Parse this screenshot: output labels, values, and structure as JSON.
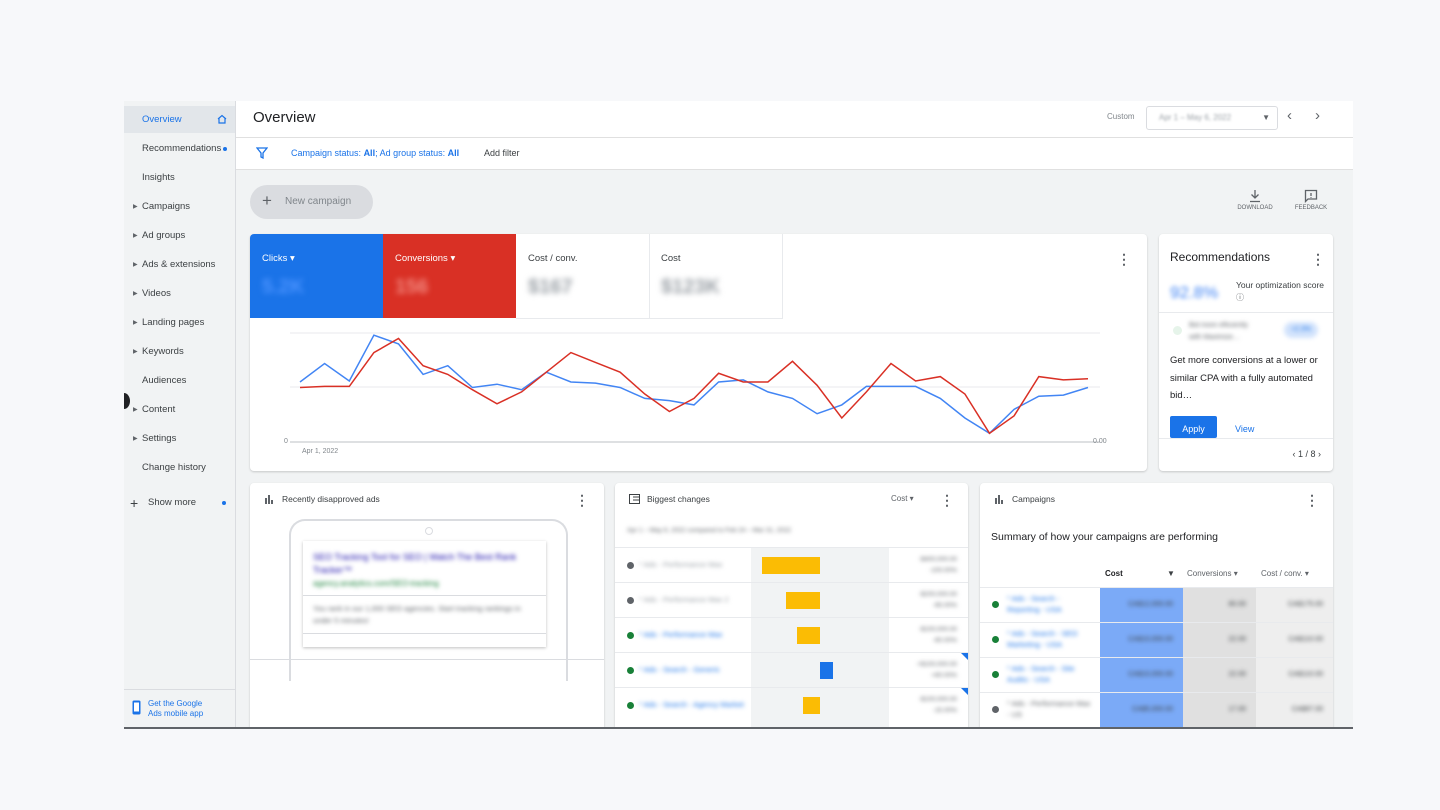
{
  "sidebar": {
    "items": [
      {
        "label": "Overview",
        "active": true
      },
      {
        "label": "Recommendations"
      },
      {
        "label": "Insights"
      },
      {
        "label": "Campaigns",
        "expandable": true
      },
      {
        "label": "Ad groups",
        "expandable": true
      },
      {
        "label": "Ads & extensions",
        "expandable": true
      },
      {
        "label": "Videos",
        "expandable": true
      },
      {
        "label": "Landing pages",
        "expandable": true
      },
      {
        "label": "Keywords",
        "expandable": true
      },
      {
        "label": "Audiences"
      },
      {
        "label": "Content",
        "expandable": true
      },
      {
        "label": "Settings",
        "expandable": true
      },
      {
        "label": "Change history"
      }
    ],
    "show_more": "Show more",
    "mobile_app": {
      "line1": "Get the Google",
      "line2": "Ads mobile app"
    }
  },
  "header": {
    "title": "Overview",
    "custom_label": "Custom",
    "date_range": "Apr 1 – May 6, 2022"
  },
  "filter": {
    "campaign_status_label": "Campaign status:",
    "campaign_status_value": "All",
    "ad_group_status_label": "Ad group status:",
    "ad_group_status_value": "All",
    "add_filter": "Add filter"
  },
  "new_campaign": "New campaign",
  "toolbar": {
    "download": "DOWNLOAD",
    "feedback": "FEEDBACK"
  },
  "kpis": [
    {
      "name": "Clicks",
      "value": "5.2K",
      "color": "#1a73e8"
    },
    {
      "name": "Conversions",
      "value": "156",
      "color": "#d93025"
    },
    {
      "name": "Cost / conv.",
      "value": "$167"
    },
    {
      "name": "Cost",
      "value": "$123K"
    }
  ],
  "chart_data": {
    "type": "line",
    "x_start_label": "Apr 1, 2022",
    "left_axis_ticks": [
      "0"
    ],
    "right_axis_ticks": [
      "0.00"
    ],
    "series": [
      {
        "name": "Clicks",
        "color": "#4285f4",
        "values": [
          55,
          72,
          56,
          98,
          90,
          62,
          70,
          50,
          53,
          48,
          64,
          55,
          54,
          50,
          40,
          38,
          34,
          55,
          57,
          46,
          40,
          26,
          34,
          51,
          51,
          51,
          40,
          22,
          8,
          30,
          42,
          43,
          50
        ]
      },
      {
        "name": "Conversions",
        "color": "#d93025",
        "values": [
          50,
          51,
          51,
          82,
          95,
          70,
          62,
          48,
          35,
          46,
          64,
          82,
          73,
          64,
          44,
          28,
          40,
          63,
          55,
          55,
          74,
          52,
          22,
          46,
          72,
          56,
          60,
          44,
          8,
          24,
          60,
          57,
          58
        ]
      }
    ]
  },
  "recommendations": {
    "title": "Recommendations",
    "score": "92.8%",
    "score_label": "Your optimization score",
    "item_title": "Bid more efficiently with Maximize…",
    "item_badge": "+2.3%",
    "body": "Get more conversions at a lower or similar CPA with a fully automated bid…",
    "apply": "Apply",
    "view": "View",
    "pager": "1 / 8"
  },
  "disapproved": {
    "title": "Recently disapproved ads",
    "ad_headline": "SEO Tracking Tool for SEO | Watch The Best Rank Tracker™",
    "ad_url": "agency.analytics.com/SEO-tracking",
    "ad_desc": "You rank in our 1,000 SEO agencies. Start tracking rankings in under 5 minutes!"
  },
  "changes": {
    "title": "Biggest changes",
    "metric": "Cost",
    "subtitle": "Apr 1 – May 6, 2022 compared to Feb 24 – Mar 31, 2022",
    "rows": [
      {
        "name": "* Ads - Performance Max",
        "dot": "#5f6368",
        "value": "-$400,000.00",
        "pct": "-100.00%",
        "dir": "neg",
        "mag": 0.78
      },
      {
        "name": "* Ads - Performance Max 2",
        "dot": "#5f6368",
        "value": "-$200,000.00",
        "pct": "-65.00%",
        "dir": "neg",
        "mag": 0.45
      },
      {
        "name": "* Ads - Performance Max",
        "dot": "#188038",
        "value": "-$100,000.00",
        "pct": "-60.00%",
        "dir": "neg",
        "mag": 0.31
      },
      {
        "name": "* Ads - Search - Generic",
        "dot": "#188038",
        "value": "+$100,000.00",
        "pct": "+80.00%",
        "dir": "pos",
        "mag": 0.25
      },
      {
        "name": "* Ads - Search - Agency Marketing Dashboards",
        "dot": "#188038",
        "value": "-$100,000.00",
        "pct": "-15.00%",
        "dir": "neg",
        "mag": 0.23
      }
    ]
  },
  "campaigns": {
    "title": "Campaigns",
    "summary": "Summary of how your campaigns are performing",
    "columns": [
      "Cost",
      "Conversions",
      "Cost / conv."
    ],
    "rows": [
      {
        "name": "* Ads - Search - Reporting - USA",
        "dot": "#188038",
        "cost": "CA$12,000.00",
        "conv": "80.00",
        "cpc": "CA$175.00"
      },
      {
        "name": "* Ads - Search - SEO Marketing - USA",
        "dot": "#188038",
        "cost": "CA$10,000.00",
        "conv": "22.00",
        "cpc": "CA$110.00"
      },
      {
        "name": "* Ads - Search - Site Audits - USA",
        "dot": "#188038",
        "cost": "CA$10,000.00",
        "conv": "22.00",
        "cpc": "CA$110.00"
      },
      {
        "name": "* Ads - Performance Max - US",
        "dot": "#5f6368",
        "cost": "CA$5,000.00",
        "conv": "17.00",
        "cpc": "CA$97.00"
      }
    ]
  }
}
